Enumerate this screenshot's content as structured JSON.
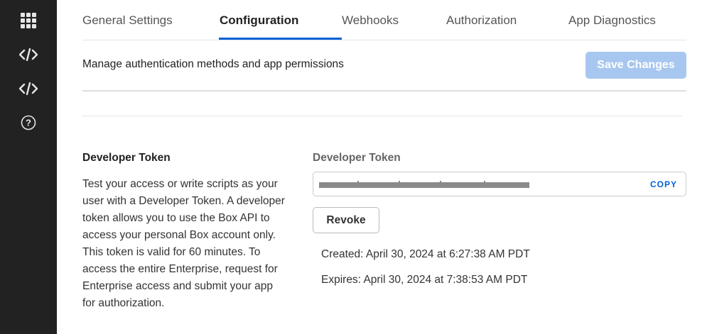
{
  "sidebar": {
    "icons": [
      {
        "name": "grid-icon"
      },
      {
        "name": "code-icon"
      },
      {
        "name": "code-icon"
      },
      {
        "name": "help-icon"
      }
    ]
  },
  "tabs": [
    {
      "label": "General Settings",
      "active": false
    },
    {
      "label": "Configuration",
      "active": true
    },
    {
      "label": "Webhooks",
      "active": false
    },
    {
      "label": "Authorization",
      "active": false
    },
    {
      "label": "App Diagnostics",
      "active": false
    }
  ],
  "subheader": {
    "text": "Manage authentication methods and app permissions",
    "save_label": "Save Changes"
  },
  "developer_token": {
    "section_title": "Developer Token",
    "description": "Test your access or write scripts as your user with a Developer Token. A developer token allows you to use the Box API to access your personal Box account only. This token is valid for 60 minutes. To access the entire Enterprise, request for Enterprise access and submit your app for authorization.",
    "field_label": "Developer Token",
    "copy_label": "COPY",
    "revoke_label": "Revoke",
    "created": "Created: April 30, 2024 at 6:27:38 AM PDT",
    "expires": "Expires: April 30, 2024 at 7:38:53 AM PDT"
  },
  "colors": {
    "sidebar_bg": "#222222",
    "accent": "#0061d5",
    "save_disabled": "#a7c7f0"
  }
}
